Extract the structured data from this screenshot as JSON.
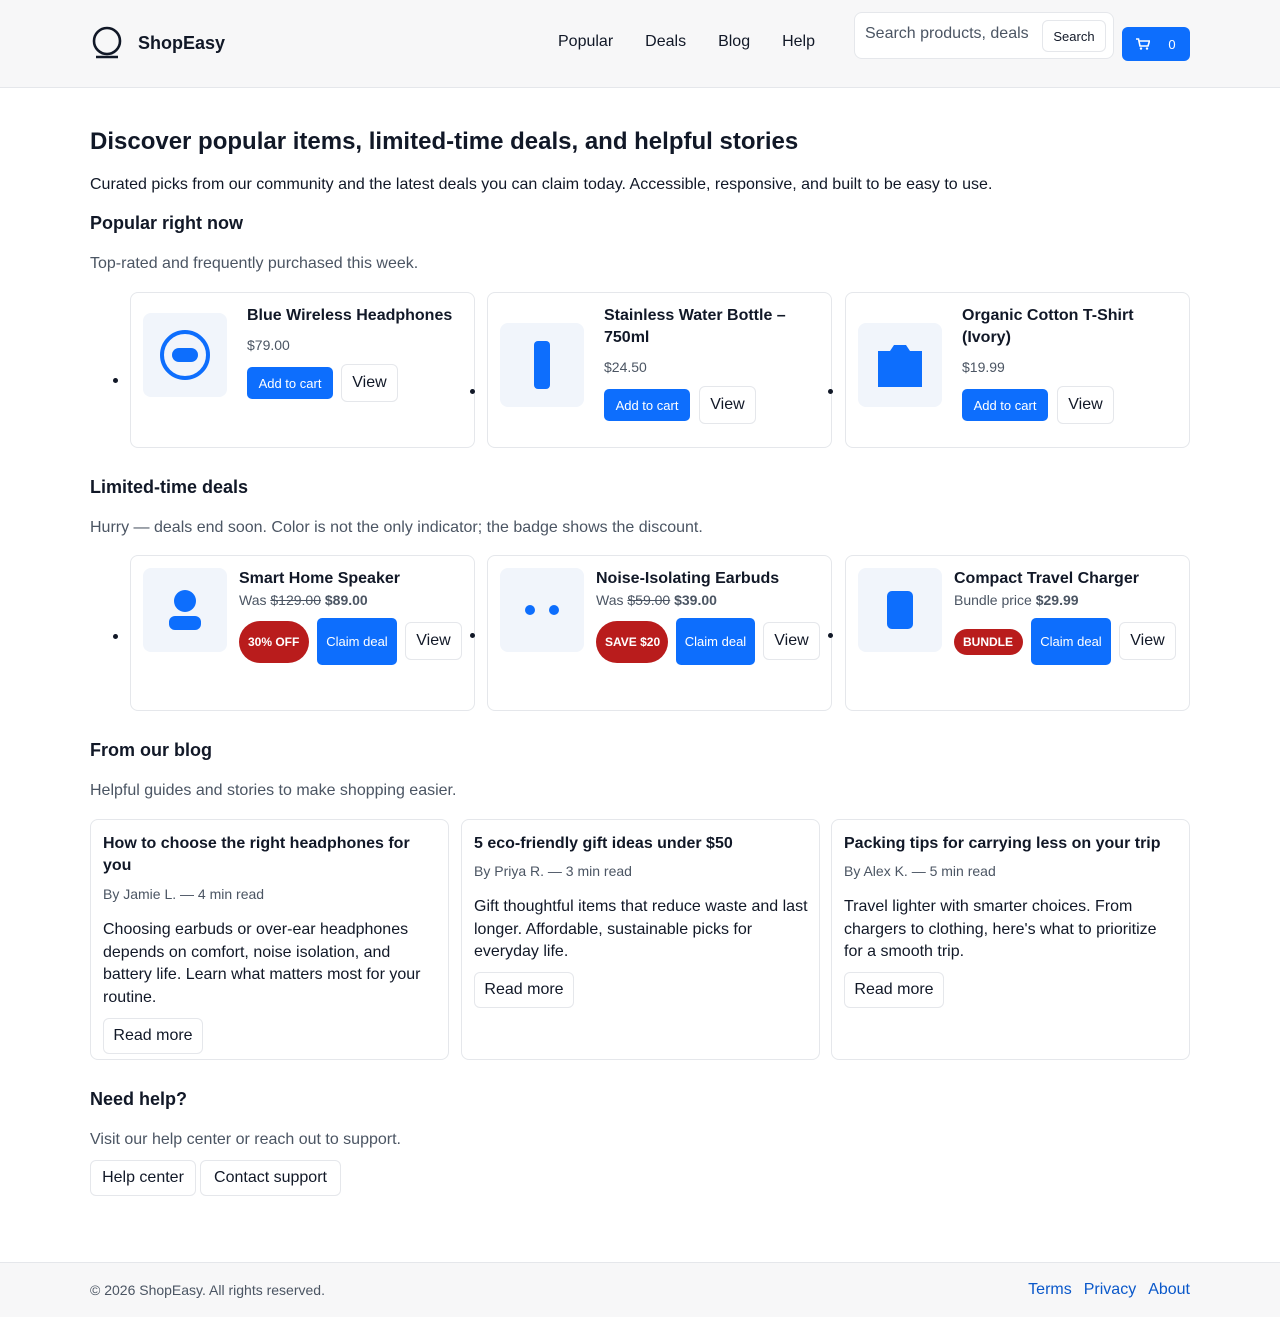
{
  "brand": {
    "name": "ShopEasy",
    "accent": "#0d6efd",
    "logo_icon": "ring-logo-icon"
  },
  "nav": {
    "items": [
      "Popular",
      "Deals",
      "Blog",
      "Help"
    ]
  },
  "search": {
    "placeholder": "Search products, deals",
    "button": "Search"
  },
  "cart": {
    "icon": "cart-icon",
    "count": "0"
  },
  "hero": {
    "title": "Discover popular items, limited-time deals, and helpful stories",
    "intro": "Curated picks from our community and the latest deals you can claim today. Accessible, responsive, and built to be easy to use."
  },
  "popular": {
    "heading": "Popular right now",
    "subheading": "Top-rated and frequently purchased this week.",
    "items": [
      {
        "title": "Blue Wireless Headphones",
        "price": "$79.00",
        "icon": "headphones-icon",
        "add": "Add to cart",
        "view": "View"
      },
      {
        "title": "Stainless Water Bottle – 750ml",
        "price": "$24.50",
        "icon": "bottle-icon",
        "add": "Add to cart",
        "view": "View"
      },
      {
        "title": "Organic Cotton T-Shirt (Ivory)",
        "price": "$19.99",
        "icon": "tshirt-icon",
        "add": "Add to cart",
        "view": "View"
      }
    ]
  },
  "deals": {
    "heading": "Limited-time deals",
    "subheading": "Hurry — deals end soon. Color is not the only indicator; the badge shows the discount.",
    "badge_color": "#b91c1c",
    "items": [
      {
        "title": "Smart Home Speaker",
        "price_prefix": "Was",
        "old_price": "$129.00",
        "new_price": "$89.00",
        "badge": "30% OFF",
        "icon": "speaker-icon",
        "claim": "Claim deal",
        "view": "View"
      },
      {
        "title": "Noise-Isolating Earbuds",
        "price_prefix": "Was",
        "old_price": "$59.00",
        "new_price": "$39.00",
        "badge": "SAVE $20",
        "icon": "earbuds-icon",
        "claim": "Claim deal",
        "view": "View"
      },
      {
        "title": "Compact Travel Charger",
        "price_prefix": "Bundle price",
        "old_price": "",
        "new_price": "$29.99",
        "badge": "BUNDLE",
        "icon": "charger-icon",
        "claim": "Claim deal",
        "view": "View"
      }
    ]
  },
  "blog": {
    "heading": "From our blog",
    "subheading": "Helpful guides and stories to make shopping easier.",
    "posts": [
      {
        "title": "How to choose the right headphones for you",
        "meta": "By Jamie L. — 4 min read",
        "excerpt": "Choosing earbuds or over-ear headphones depends on comfort, noise isolation, and battery life. Learn what matters most for your routine.",
        "cta": "Read more"
      },
      {
        "title": "5 eco-friendly gift ideas under $50",
        "meta": "By Priya R. — 3 min read",
        "excerpt": "Gift thoughtful items that reduce waste and last longer. Affordable, sustainable picks for everyday life.",
        "cta": "Read more"
      },
      {
        "title": "Packing tips for carrying less on your trip",
        "meta": "By Alex K. — 5 min read",
        "excerpt": "Travel lighter with smarter choices. From chargers to clothing, here's what to prioritize for a smooth trip.",
        "cta": "Read more"
      }
    ]
  },
  "help": {
    "heading": "Need help?",
    "subheading": "Visit our help center or reach out to support.",
    "buttons": [
      "Help center",
      "Contact support"
    ]
  },
  "footer": {
    "copyright": "© 2026 ShopEasy. All rights reserved.",
    "links": [
      "Terms",
      "Privacy",
      "About"
    ]
  }
}
